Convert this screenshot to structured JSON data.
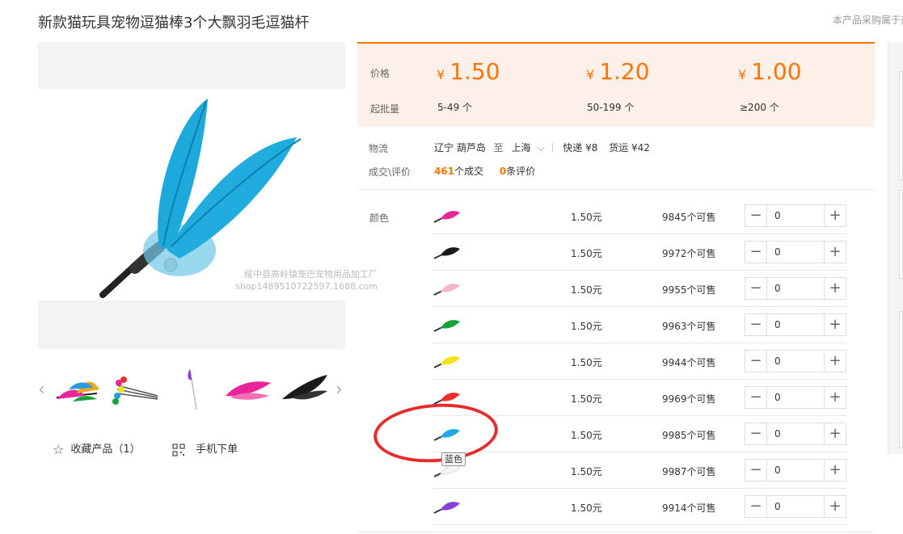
{
  "product": {
    "title": "新款猫玩具宠物逗猫棒3个大飘羽毛逗猫杆",
    "note": "本产品采购属于商"
  },
  "gallery": {
    "watermark_line1": "绥中县高岭镇宠巴宠物用品加工厂",
    "watermark_line2": "shop1489510722597.1688.com",
    "prev_arrow": "‹",
    "next_arrow": "›",
    "thumbs": [
      "multi-feather",
      "multi-bundle",
      "purple-single",
      "pink-feather",
      "black-feather"
    ]
  },
  "actions": {
    "favorite_icon": "☆",
    "favorite_label": "收藏产品（1）",
    "mobile_icon": "qr-code-icon",
    "mobile_label": "手机下单"
  },
  "pricing": {
    "price_label": "价格",
    "min_label": "起批量",
    "currency": "¥",
    "tiers": [
      {
        "price": "1.50",
        "range": "5-49 个"
      },
      {
        "price": "1.20",
        "range": "50-199 个"
      },
      {
        "price": "1.00",
        "range": "≥200 个"
      }
    ],
    "accent": "#ff7300"
  },
  "logistics": {
    "label": "物流",
    "from": "辽宁 葫芦岛",
    "to_word": "至",
    "to": "上海",
    "express": "快递 ¥8",
    "freight": "货运 ¥42",
    "deals_label": "成交\\评价",
    "deals_count": "461",
    "deals_suffix": "个成交",
    "reviews_count": "0",
    "reviews_suffix": "条评价"
  },
  "sku": {
    "color_label": "颜色",
    "tooltip": "蓝色",
    "rows": [
      {
        "color": "#e8269a",
        "price": "1.50元",
        "stock": "9845个可售",
        "qty": "0"
      },
      {
        "color": "#1a1a1a",
        "price": "1.50元",
        "stock": "9972个可售",
        "qty": "0"
      },
      {
        "color": "#f5b6cf",
        "price": "1.50元",
        "stock": "9955个可售",
        "qty": "0"
      },
      {
        "color": "#17a33a",
        "price": "1.50元",
        "stock": "9963个可售",
        "qty": "0"
      },
      {
        "color": "#f2e21c",
        "price": "1.50元",
        "stock": "9944个可售",
        "qty": "0"
      },
      {
        "color": "#e8302e",
        "price": "1.50元",
        "stock": "9969个可售",
        "qty": "0"
      },
      {
        "color": "#1fa7e6",
        "price": "1.50元",
        "stock": "9985个可售",
        "qty": "0"
      },
      {
        "color": "#f4f4f4",
        "price": "1.50元",
        "stock": "9987个可售",
        "qty": "0"
      },
      {
        "color": "#8a3fd6",
        "price": "1.50元",
        "stock": "9914个可售",
        "qty": "0"
      }
    ]
  }
}
